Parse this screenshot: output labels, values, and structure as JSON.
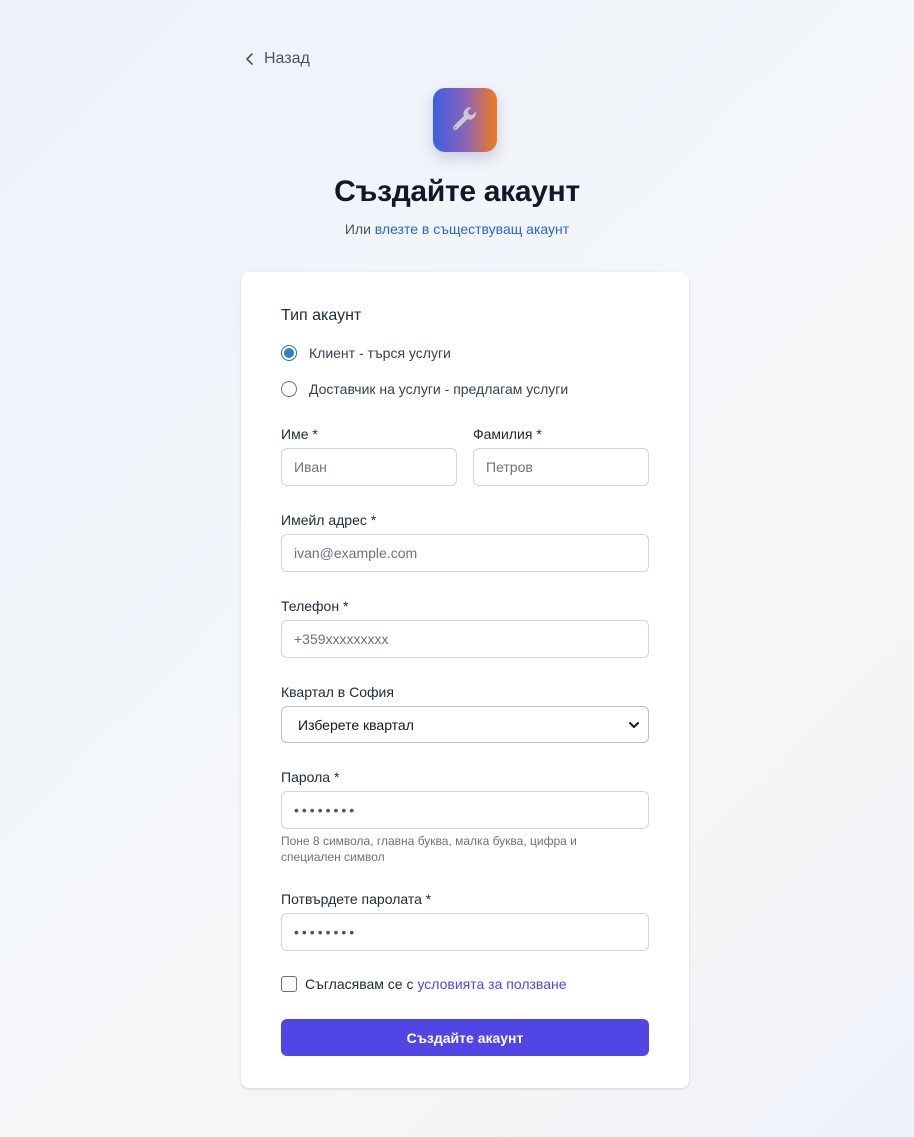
{
  "nav": {
    "back_label": "Назад"
  },
  "header": {
    "title": "Създайте акаунт",
    "subtitle_prefix": "Или",
    "login_link": "влезте в съществуващ акаунт"
  },
  "form": {
    "account_type_label": "Тип акаунт",
    "account_types": [
      {
        "label": "Клиент - търся услуги",
        "checked": true
      },
      {
        "label": "Доставчик на услуги - предлагам услуги",
        "checked": false
      }
    ],
    "first_name": {
      "label": "Име *",
      "placeholder": "Иван",
      "value": ""
    },
    "last_name": {
      "label": "Фамилия *",
      "placeholder": "Петров",
      "value": ""
    },
    "email": {
      "label": "Имейл адрес *",
      "placeholder": "ivan@example.com",
      "value": ""
    },
    "phone": {
      "label": "Телефон *",
      "placeholder": "+359xxxxxxxxx",
      "value": ""
    },
    "district": {
      "label": "Квартал в София",
      "selected": "Изберете квартал"
    },
    "password": {
      "label": "Парола *",
      "mask": "••••••••",
      "hint": "Поне 8 символа, главна буква, малка буква, цифра и специален символ"
    },
    "confirm_password": {
      "label": "Потвърдете паролата *",
      "mask": "••••••••"
    },
    "terms": {
      "prefix": "Съгласявам се с",
      "link": "условията за ползване",
      "checked": false
    },
    "submit_label": "Създайте акаунт"
  },
  "colors": {
    "accent": "#4f46e5",
    "link": "#2563eb",
    "radio_selected": "#2f80c9",
    "logo_gradient_start": "#3b5fe0",
    "logo_gradient_end": "#f07a22"
  },
  "icons": {
    "back": "chevron-left-icon",
    "logo": "wrench-icon",
    "select": "chevron-down-icon"
  }
}
